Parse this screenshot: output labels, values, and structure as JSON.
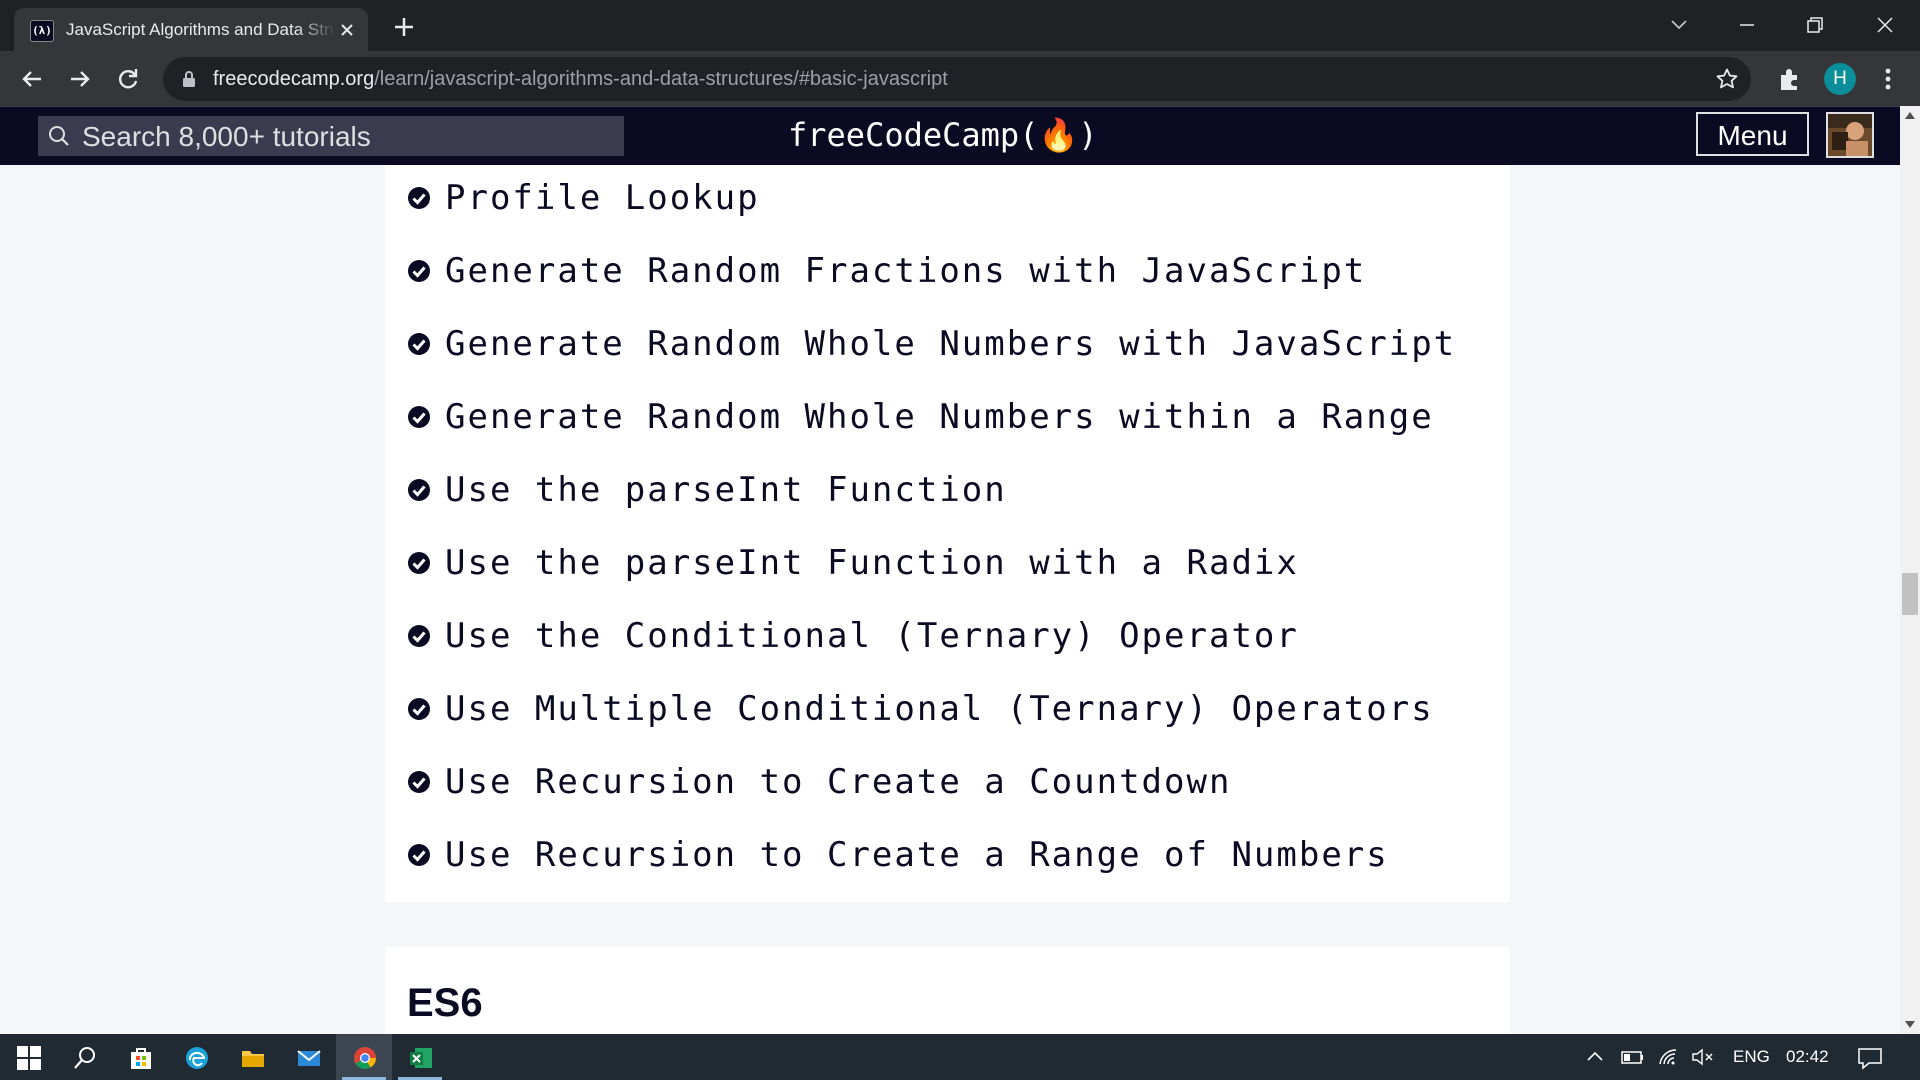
{
  "browser": {
    "tab_title": "JavaScript Algorithms and Data Structures",
    "favicon_text": "(λ)",
    "url_host": "freecodecamp.org",
    "url_path": "/learn/javascript-algorithms-and-data-structures/#basic-javascript",
    "profile_initial": "H"
  },
  "site": {
    "search_placeholder": "Search 8,000+ tutorials",
    "logo_text": "freeCodeCamp(🔥)",
    "menu_label": "Menu"
  },
  "lessons": [
    "Profile Lookup",
    "Generate Random Fractions with JavaScript",
    "Generate Random Whole Numbers with JavaScript",
    "Generate Random Whole Numbers within a Range",
    "Use the parseInt Function",
    "Use the parseInt Function with a Radix",
    "Use the Conditional (Ternary) Operator",
    "Use Multiple Conditional (Ternary) Operators",
    "Use Recursion to Create a Countdown",
    "Use Recursion to Create a Range of Numbers"
  ],
  "next_section_title": "ES6",
  "taskbar": {
    "language": "ENG",
    "time": "02:42"
  }
}
